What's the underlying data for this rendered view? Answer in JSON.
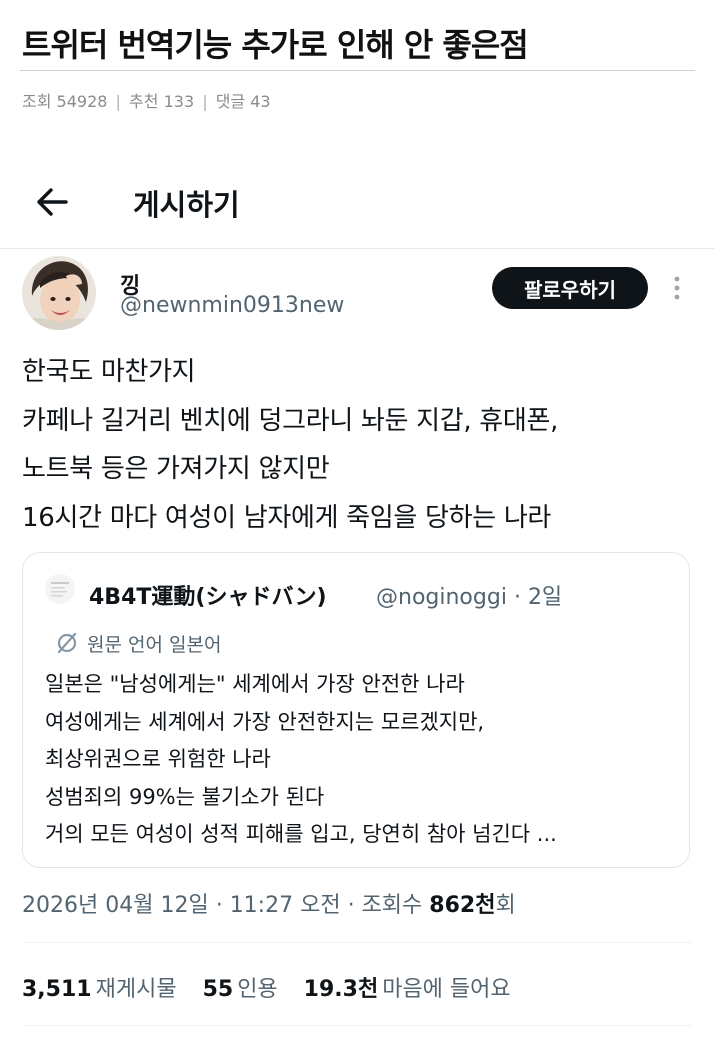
{
  "post": {
    "title": "트위터 번역기능 추가로 인해 안 좋은점",
    "views_label": "조회",
    "views": "54928",
    "recommend_label": "추천",
    "recommend": "133",
    "comments_label": "댓글",
    "comments": "43",
    "separator": "|"
  },
  "header": {
    "back_icon": "arrow-left-icon",
    "title": "게시하기"
  },
  "tweet": {
    "display_name": "낑",
    "handle": "@newnmin0913new",
    "follow_label": "팔로우하기",
    "more_icon": "more-vertical-icon",
    "lines": [
      "한국도 마찬가지",
      "카페나 길거리 벤치에 덩그라니 놔둔 지갑, 휴대폰,",
      "노트북 등은 가져가지 않지만",
      "16시간 마다 여성이 남자에게 죽임을 당하는 나라"
    ],
    "timestamp": {
      "date": "2026년 04월 12일",
      "dot": "·",
      "time": "11:27 오전",
      "views_label": "조회수",
      "views_value": "862천",
      "views_suffix": "회"
    },
    "stats": {
      "retweets_value": "3,511",
      "retweets_label": "재게시물",
      "quotes_value": "55",
      "quotes_label": "인용",
      "likes_value": "19.3천",
      "likes_label": "마음에 들어요"
    }
  },
  "quoted": {
    "name": "4B4T運動(シャドバン)",
    "handle": "@noginoggi",
    "dot": "·",
    "age": "2일",
    "translate_icon": "translate-icon",
    "translate_label": "원문 언어 일본어",
    "lines": [
      "일본은 \"남성에게는\" 세계에서 가장 안전한 나라",
      "여성에게는 세계에서 가장 안전한지는 모르겠지만,",
      "최상위권으로 위험한 나라",
      "성범죄의 99%는 불기소가 된다",
      "거의 모든 여성이 성적 피해를 입고, 당연히 참아 넘긴다  ..."
    ]
  }
}
